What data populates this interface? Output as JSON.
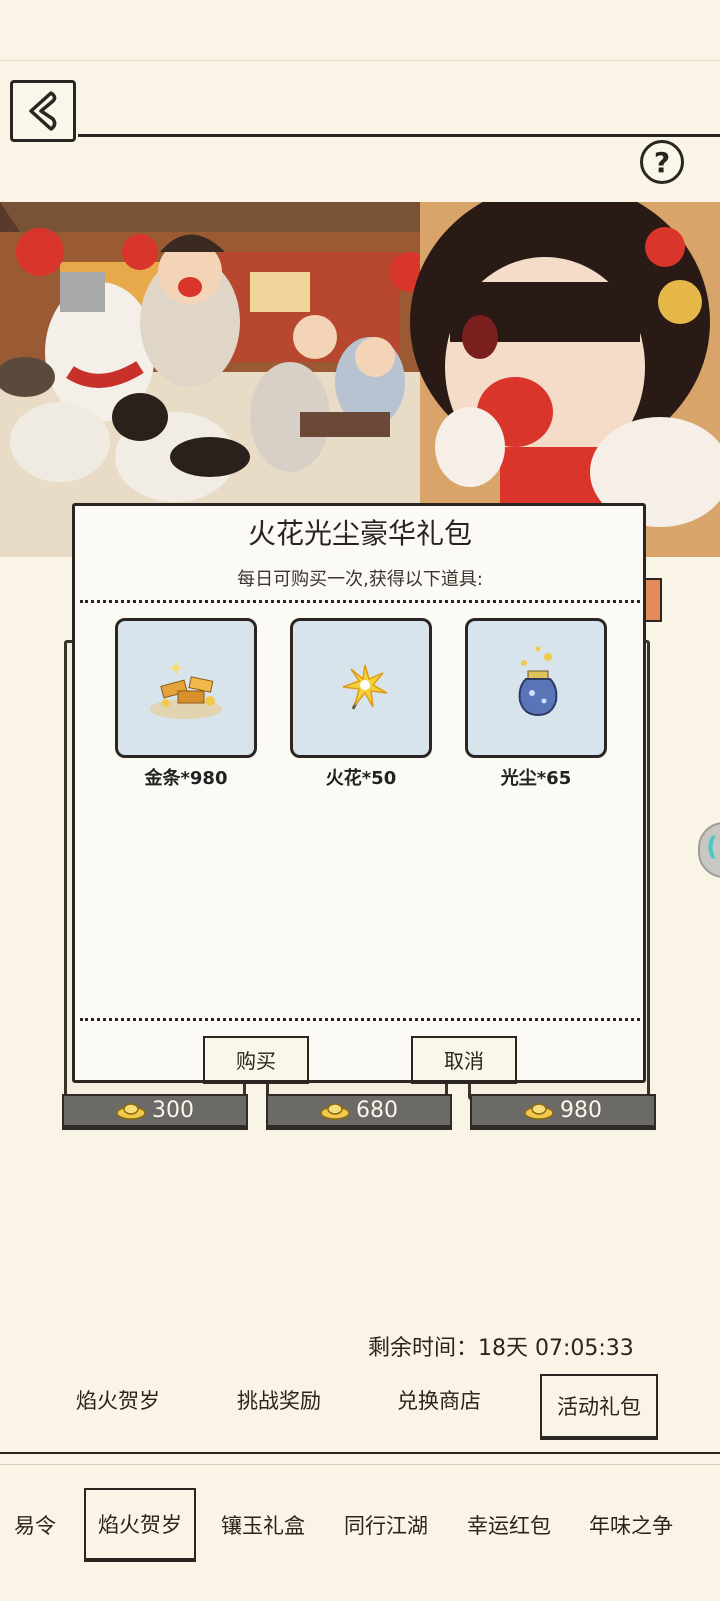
{
  "header": {
    "back_icon": "chevron-left-icon",
    "help_label": "?"
  },
  "dialog": {
    "title": "火花光尘豪华礼包",
    "subtitle": "每日可购买一次,获得以下道具:",
    "items": [
      {
        "label": "金条*980",
        "icon": "gold-bars-icon"
      },
      {
        "label": "火花*50",
        "icon": "sparkler-icon"
      },
      {
        "label": "光尘*65",
        "icon": "stardust-jar-icon"
      }
    ],
    "buy_label": "购买",
    "cancel_label": "取消"
  },
  "packages": [
    {
      "price": "300"
    },
    {
      "price": "680"
    },
    {
      "price": "980"
    }
  ],
  "timer": {
    "text": "剩余时间：18天 07:05:33"
  },
  "event_tabs": [
    {
      "label": "焰火贺岁",
      "selected": false
    },
    {
      "label": "挑战奖励",
      "selected": false
    },
    {
      "label": "兑换商店",
      "selected": false
    },
    {
      "label": "活动礼包",
      "selected": true
    }
  ],
  "bottom_tabs": [
    {
      "label": "易令",
      "selected": false
    },
    {
      "label": "焰火贺岁",
      "selected": true
    },
    {
      "label": "镶玉礼盒",
      "selected": false
    },
    {
      "label": "同行江湖",
      "selected": false
    },
    {
      "label": "幸运红包",
      "selected": false
    },
    {
      "label": "年味之争",
      "selected": false
    }
  ],
  "colors": {
    "background": "#faf4e6",
    "item_box": "#d7e4ec",
    "price_bar": "#6c6a67",
    "ink": "#2b2622"
  }
}
